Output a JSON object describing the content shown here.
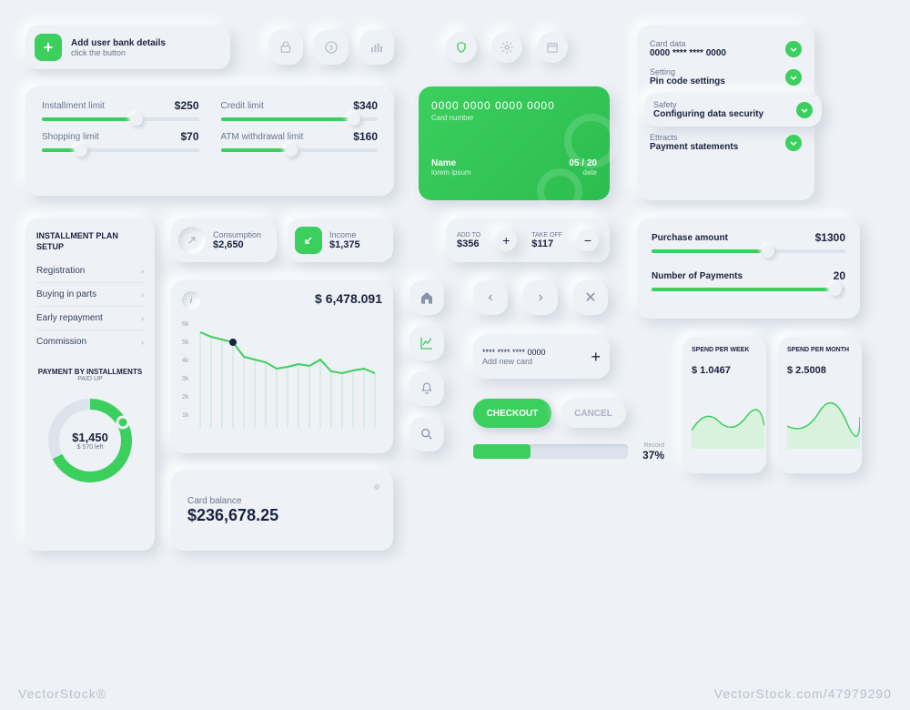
{
  "add_user": {
    "title": "Add user bank details",
    "sub": "click the button"
  },
  "limits": [
    {
      "label": "Installment limit",
      "value": "$250",
      "pct": 60
    },
    {
      "label": "Credit limit",
      "value": "$340",
      "pct": 85
    },
    {
      "label": "Shopping limit",
      "value": "$70",
      "pct": 25
    },
    {
      "label": "ATM withdrawal limit",
      "value": "$160",
      "pct": 45
    }
  ],
  "card": {
    "number": "0000 0000 0000 0000",
    "number_label": "Card number",
    "name_label": "Name",
    "name": "lorem ipsum",
    "date": "05 / 20",
    "date_label": "date"
  },
  "settings": [
    {
      "label": "Card data",
      "value": "0000 **** **** 0000"
    },
    {
      "label": "Setting",
      "value": "Pin code settings"
    },
    {
      "label": "Safety",
      "value": "Configuring data security"
    },
    {
      "label": "Ettracts",
      "value": "Payment statements"
    }
  ],
  "plan": {
    "title": "INSTALLMENT PLAN SETUP",
    "items": [
      "Registration",
      "Buying in parts",
      "Early repayment",
      "Commission"
    ],
    "pay_title": "PAYMENT BY INSTALLMENTS",
    "pay_sub": "PAID UP",
    "amount": "$1,450",
    "left": "$ 570 left"
  },
  "stats": {
    "consumption_label": "Consumption",
    "consumption": "$2,650",
    "income_label": "Income",
    "income": "$1,375"
  },
  "addto": {
    "add_label": "ADD TO",
    "add_val": "$356",
    "take_label": "TAKE OFF",
    "take_val": "$117"
  },
  "purchase": {
    "label1": "Purchase amount",
    "val1": "$1300",
    "pct1": 60,
    "label2": "Number of Payments",
    "val2": "20",
    "pct2": 95
  },
  "chart": {
    "value": "$ 6,478.091",
    "yticks": [
      "6k",
      "5k",
      "4k",
      "3k",
      "2k",
      "1k"
    ]
  },
  "card_balance": {
    "label": "Card balance",
    "value": "$236,678.25"
  },
  "newcard": {
    "mask": "**** **** **** 0000",
    "label": "Add new card"
  },
  "buttons": {
    "checkout": "CHECKOUT",
    "cancel": "CANCEL"
  },
  "progress": {
    "label": "Record",
    "value": "37%"
  },
  "spend": {
    "week_label": "SPEND PER WEEK",
    "week_val": "$ 1.0467",
    "month_label": "SPEND PER MONTH",
    "month_val": "$ 2.5008"
  },
  "chart_data": {
    "type": "line",
    "title": "",
    "ylabel": "",
    "yticks": [
      1,
      2,
      3,
      4,
      5,
      6
    ],
    "values": [
      6.0,
      5.6,
      5.4,
      5.2,
      4.2,
      4.0,
      3.8,
      3.4,
      3.5,
      3.7,
      3.6,
      4.0,
      3.3,
      3.2,
      3.4,
      3.5,
      3.2,
      3.5
    ]
  },
  "footer": {
    "brand": "VectorStock®",
    "id": "VectorStock.com/47979290"
  }
}
